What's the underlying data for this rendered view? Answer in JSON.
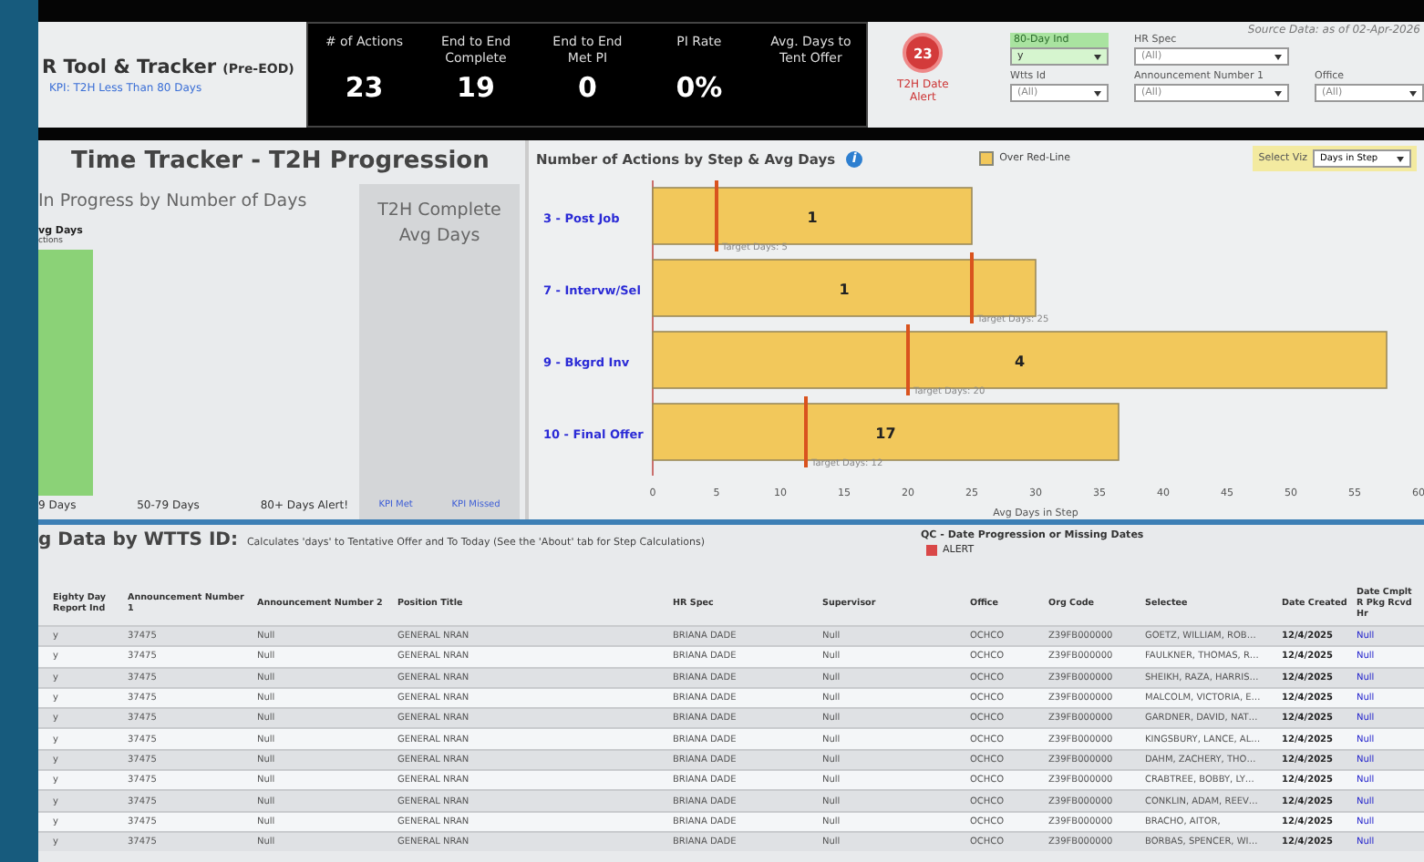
{
  "header": {
    "title": "R Tool & Tracker",
    "title_suffix": "(Pre-EOD)",
    "kpi_note": "KPI: T2H Less Than 80 Days",
    "source_note": "Source Data: as of 02-Apr-2026"
  },
  "kpis": [
    {
      "label": "# of Actions",
      "value": "23"
    },
    {
      "label": "End to End Complete",
      "value": "19"
    },
    {
      "label": "End to End Met PI",
      "value": "0"
    },
    {
      "label": "PI Rate",
      "value": "0%"
    },
    {
      "label": "Avg. Days to Tent Offer"
    }
  ],
  "alert": {
    "count": "23",
    "label": "T2H Date Alert"
  },
  "filters": [
    {
      "label": "80-Day Ind",
      "value": "y",
      "selected": true
    },
    {
      "label": "HR Spec",
      "value": "(All)",
      "selected": false
    },
    {
      "label": "Wtts Id",
      "value": "(All)",
      "selected": false
    },
    {
      "label": "Announcement Number 1",
      "value": "(All)",
      "selected": false
    },
    {
      "label": "Office",
      "value": "(All)",
      "selected": false
    }
  ],
  "progress_panel": {
    "title": "Time Tracker - T2H Progression",
    "subtitle": "In Progress by Number of Days",
    "legend_title": "vg Days",
    "legend_sub": "ctions",
    "bands": [
      "9 Days",
      "50-79 Days",
      "80+ Days Alert!"
    ],
    "complete_title": "T2H Complete Avg Days",
    "complete_labels": [
      "KPI Met",
      "KPI Missed"
    ]
  },
  "step_chart": {
    "info": "i",
    "legend": "Over Red-Line",
    "select_label": "Select Viz",
    "select_value": "Days in Step",
    "bar_counts": [
      "1",
      "1",
      "4",
      "17"
    ],
    "chart_data": {
      "type": "bar",
      "orientation": "horizontal",
      "title": "Number of Actions by Step &  Avg Days",
      "xlabel": "Avg Days in Step",
      "categories": [
        "3 - Post Job",
        "7 - Intervw/Sel",
        "9 - Bkgrd Inv",
        "10 - Final Offer"
      ],
      "values": [
        25,
        30,
        57.5,
        36.5
      ],
      "xlim": [
        0,
        60
      ],
      "xticks": [
        {
          "value": 0,
          "label": "0"
        },
        {
          "value": 5,
          "label": "5"
        },
        {
          "value": 10,
          "label": "10"
        },
        {
          "value": 15,
          "label": "15"
        },
        {
          "value": 20,
          "label": "20"
        },
        {
          "value": 25,
          "label": "25"
        },
        {
          "value": 30,
          "label": "30"
        },
        {
          "value": 35,
          "label": "35"
        },
        {
          "value": 40,
          "label": "40"
        },
        {
          "value": 45,
          "label": "45"
        },
        {
          "value": 50,
          "label": "50"
        },
        {
          "value": 55,
          "label": "55"
        },
        {
          "value": 60,
          "label": "60"
        }
      ],
      "annotations": [
        {
          "text": "Target Days: 5",
          "x": 5,
          "y": "3 - Post Job"
        },
        {
          "text": "Target Days: 25",
          "x": 25,
          "y": "7 - Intervw/Sel"
        },
        {
          "text": "Target Days: 20",
          "x": 20,
          "y": "9 - Bkgrd Inv"
        },
        {
          "text": "Target Days: 12",
          "x": 12,
          "y": "10 - Final Offer"
        }
      ]
    }
  },
  "table": {
    "title": "g Data by WTTS ID:",
    "note": "Calculates 'days' to Tentative Offer and To Today (See the 'About' tab for Step Calculations)",
    "qc_title": "QC - Date Progression or Missing Dates",
    "qc_label": "ALERT",
    "columns": [
      "Eighty Day Report Ind",
      "Announcement Number 1",
      "Announcement Number 2",
      "Position Title",
      "HR Spec",
      "Supervisor",
      "Office",
      "Org Code",
      "Selectee",
      "Date Created",
      "Date Cmplt R Pkg Rcvd Hr"
    ],
    "rows": [
      [
        "y",
        "37475",
        "Null",
        "GENERAL NRAN",
        "BRIANA DADE",
        "Null",
        "OCHCO",
        "Z39FB000000",
        "GOETZ, WILLIAM, ROB…",
        "12/4/2025",
        "Null"
      ],
      [
        "y",
        "37475",
        "Null",
        "GENERAL NRAN",
        "BRIANA DADE",
        "Null",
        "OCHCO",
        "Z39FB000000",
        "FAULKNER, THOMAS, R…",
        "12/4/2025",
        "Null"
      ],
      [
        "y",
        "37475",
        "Null",
        "GENERAL NRAN",
        "BRIANA DADE",
        "Null",
        "OCHCO",
        "Z39FB000000",
        "SHEIKH, RAZA, HARRIS…",
        "12/4/2025",
        "Null"
      ],
      [
        "y",
        "37475",
        "Null",
        "GENERAL NRAN",
        "BRIANA DADE",
        "Null",
        "OCHCO",
        "Z39FB000000",
        "MALCOLM, VICTORIA, E…",
        "12/4/2025",
        "Null"
      ],
      [
        "y",
        "37475",
        "Null",
        "GENERAL NRAN",
        "BRIANA DADE",
        "Null",
        "OCHCO",
        "Z39FB000000",
        "GARDNER, DAVID, NAT…",
        "12/4/2025",
        "Null"
      ],
      [
        "y",
        "37475",
        "Null",
        "GENERAL NRAN",
        "BRIANA DADE",
        "Null",
        "OCHCO",
        "Z39FB000000",
        "KINGSBURY, LANCE, AL…",
        "12/4/2025",
        "Null"
      ],
      [
        "y",
        "37475",
        "Null",
        "GENERAL NRAN",
        "BRIANA DADE",
        "Null",
        "OCHCO",
        "Z39FB000000",
        "DAHM, ZACHERY, THO…",
        "12/4/2025",
        "Null"
      ],
      [
        "y",
        "37475",
        "Null",
        "GENERAL NRAN",
        "BRIANA DADE",
        "Null",
        "OCHCO",
        "Z39FB000000",
        "CRABTREE, BOBBY, LY…",
        "12/4/2025",
        "Null"
      ],
      [
        "y",
        "37475",
        "Null",
        "GENERAL NRAN",
        "BRIANA DADE",
        "Null",
        "OCHCO",
        "Z39FB000000",
        "CONKLIN, ADAM, REEV…",
        "12/4/2025",
        "Null"
      ],
      [
        "y",
        "37475",
        "Null",
        "GENERAL NRAN",
        "BRIANA DADE",
        "Null",
        "OCHCO",
        "Z39FB000000",
        "BRACHO, AITOR,",
        "12/4/2025",
        "Null"
      ],
      [
        "y",
        "37475",
        "Null",
        "GENERAL NRAN",
        "BRIANA DADE",
        "Null",
        "OCHCO",
        "Z39FB000000",
        "BORBAS, SPENCER, WI…",
        "12/4/2025",
        "Null"
      ]
    ]
  }
}
